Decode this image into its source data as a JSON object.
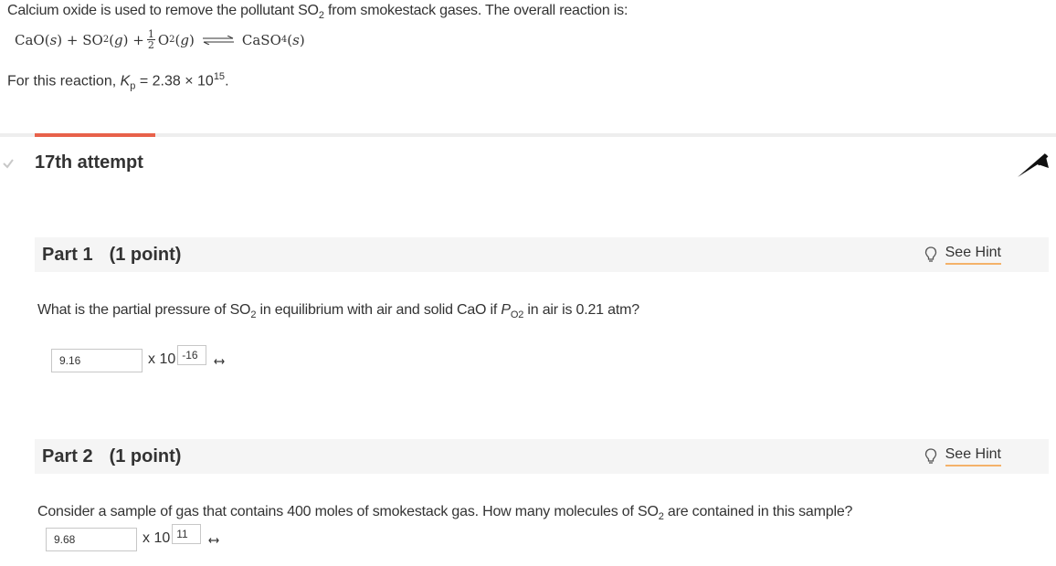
{
  "problem": {
    "intro": "Calcium oxide is used to remove the pollutant SO",
    "intro_sub": "2",
    "intro_rest": " from smokestack gases. The overall reaction is:",
    "equation": {
      "t1": "CaO(",
      "t1s": "s",
      "t1e": ") + SO",
      "sub1": "2",
      "t2": "(",
      "t2g": "g",
      "t2e": ") + ",
      "frac_num": "1",
      "frac_den": "2",
      "t3": "O",
      "sub2": "2",
      "t4": "(",
      "t4g": "g",
      "t4e": ")",
      "t5": "CaSO",
      "sub3": "4",
      "t6": "(",
      "t6s": "s",
      "t6e": ")"
    },
    "kp_prefix": "For this reaction, ",
    "kp_symbol": "K",
    "kp_sub": "p",
    "kp_value": " = 2.38 × 10",
    "kp_exp": "15",
    "kp_end": "."
  },
  "attempt": {
    "label": "17th attempt"
  },
  "parts": [
    {
      "title": "Part 1",
      "points": "(1 point)",
      "hint_label": "See Hint",
      "question_a": "What is the partial pressure of SO",
      "question_sub": "2",
      "question_b": " in equilibrium with air and solid CaO if ",
      "question_p": "P",
      "question_psub": "O2",
      "question_c": " in air is 0.21 atm?",
      "answer_value": "9.16",
      "times_label": "x 10",
      "exponent_value": "-16"
    },
    {
      "title": "Part 2",
      "points": "(1 point)",
      "hint_label": "See Hint",
      "question_a": "Consider a sample of gas that contains 400  moles of smokestack gas. How many molecules of SO",
      "question_sub": "2",
      "question_b": " are contained in this sample?",
      "answer_value": "9.68",
      "times_label": "x 10",
      "exponent_value": "11"
    }
  ],
  "colors": {
    "accent": "#e8614a",
    "hint_underline": "#f4b26a",
    "part_bar": "#f5f5f5",
    "divider": "#eeeeee",
    "check": "#c8c8c8"
  }
}
